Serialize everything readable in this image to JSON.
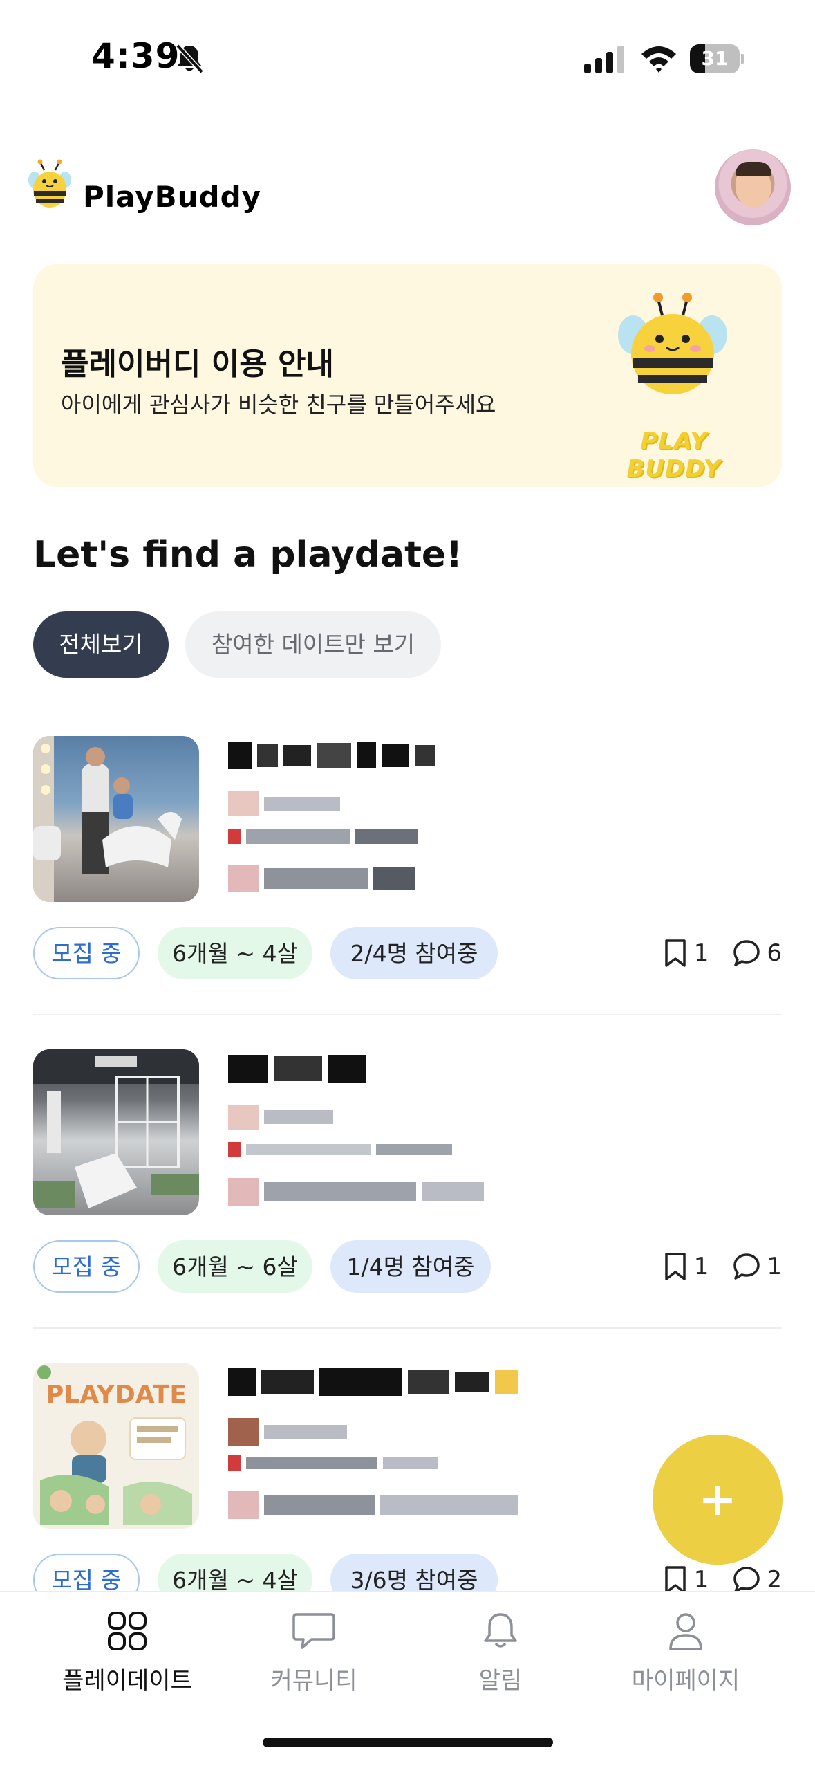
{
  "status_bar": {
    "time": "4:39",
    "battery": "31",
    "battery_level": 0.31
  },
  "header": {
    "app_name": "PlayBuddy"
  },
  "banner": {
    "title": "플레이버디 이용 안내",
    "subtitle": "아이에게 관심사가 비슷한 친구를 만들어주세요",
    "brand_text": "PLAY BUDDY"
  },
  "section": {
    "title": "Let's find a playdate!"
  },
  "filters": {
    "all": "전체보기",
    "joined_only": "참여한 데이트만 보기"
  },
  "playdates": [
    {
      "status": "모집 중",
      "age_range": "6개월 ~ 4살",
      "participants": "2/4명 참여중",
      "bookmarks": "1",
      "comments": "6"
    },
    {
      "status": "모집 중",
      "age_range": "6개월 ~ 6살",
      "participants": "1/4명 참여중",
      "bookmarks": "1",
      "comments": "1"
    },
    {
      "status": "모집 중",
      "age_range": "6개월 ~ 4살",
      "participants": "3/6명 참여중",
      "bookmarks": "1",
      "comments": "2"
    }
  ],
  "thumb3": {
    "text": "PLAYDATE"
  },
  "fab": {
    "label": "+"
  },
  "bottom_nav": {
    "items": [
      {
        "label": "플레이데이트",
        "icon": "grid-icon",
        "active": true
      },
      {
        "label": "커뮤니티",
        "icon": "chat-icon",
        "active": false
      },
      {
        "label": "알림",
        "icon": "bell-icon",
        "active": false
      },
      {
        "label": "마이페이지",
        "icon": "person-icon",
        "active": false
      }
    ]
  },
  "colors": {
    "accent_yellow": "#eccf42",
    "filter_active": "#343d4f",
    "banner_bg": "#fef8e1"
  }
}
